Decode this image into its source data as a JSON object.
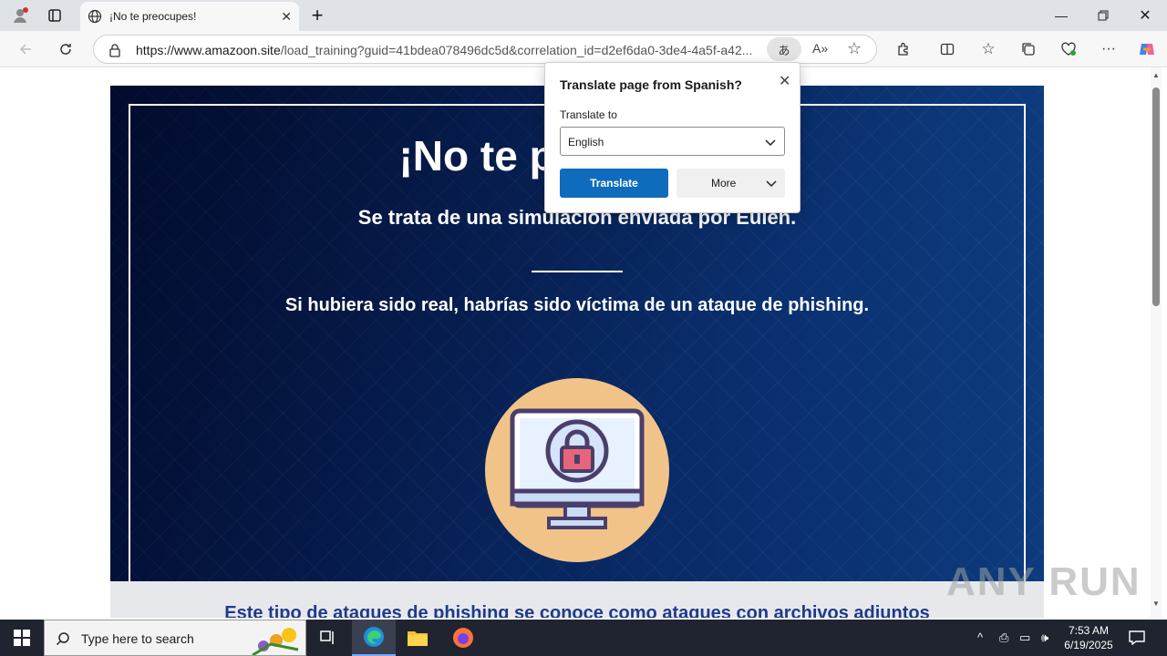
{
  "tab": {
    "title": "¡No te preocupes!"
  },
  "address": {
    "domain": "https://www.amazoon.site",
    "path": "/load_training?guid=41bdea078496dc5d&correlation_id=d2ef6da0-3de4-4a5f-a42..."
  },
  "page": {
    "heading": "¡No te preocupes!",
    "subtitle": "Se trata de una simulación enviada por Eulen.",
    "message": "Si hubiera sido real, habrías sido víctima de un ataque de phishing.",
    "lower_text": "Este tipo de ataques de phishing se conoce como ataques con archivos adjuntos"
  },
  "translate_popup": {
    "title": "Translate page from Spanish?",
    "label": "Translate to",
    "selected_language": "English",
    "translate_button": "Translate",
    "more_button": "More"
  },
  "taskbar": {
    "search_placeholder": "Type here to search",
    "time": "7:53 AM",
    "date": "6/19/2025"
  },
  "watermark": "ANY RUN",
  "colors": {
    "banner": "#06245a",
    "accent_button": "#0f6cbd",
    "lock_circle": "#f1c389",
    "lower_text": "#1f3a8a"
  }
}
